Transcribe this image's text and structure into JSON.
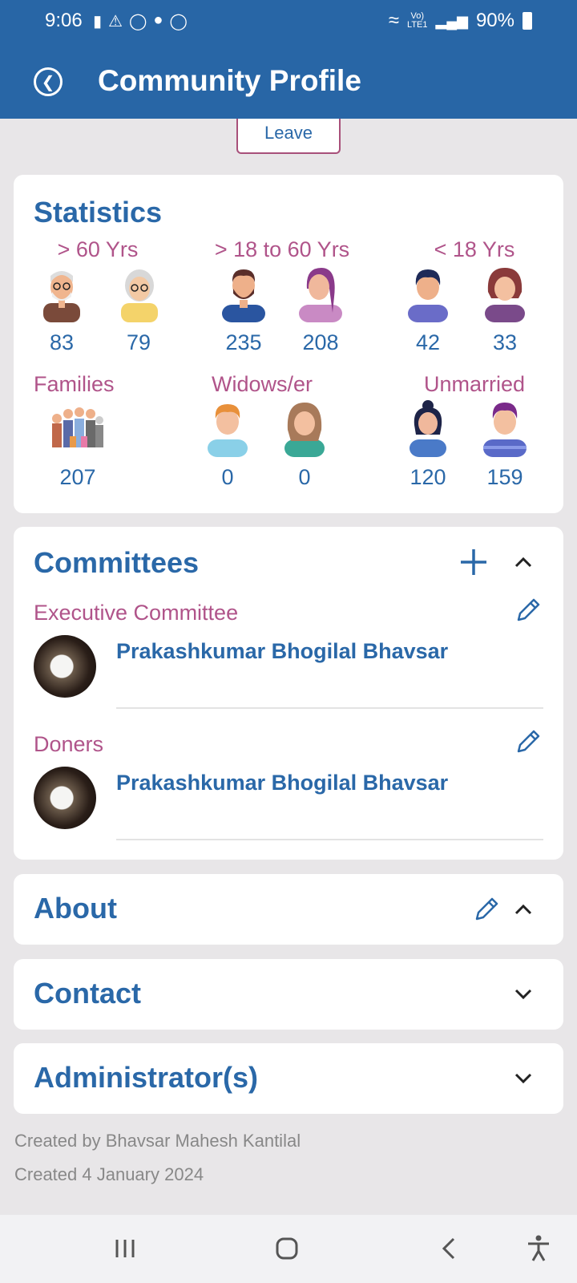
{
  "status_bar": {
    "time": "9:06",
    "network_label_top": "Vo)",
    "network_label_bottom": "LTE1",
    "battery": "90%"
  },
  "header": {
    "title": "Community Profile",
    "back_icon": "back-arrow-icon"
  },
  "leave_button": "Leave",
  "statistics": {
    "title": "Statistics",
    "age_groups": [
      {
        "label": "> 60 Yrs",
        "male": "83",
        "female": "79"
      },
      {
        "label": "> 18 to 60 Yrs",
        "male": "235",
        "female": "208"
      },
      {
        "label": "< 18 Yrs",
        "male": "42",
        "female": "33"
      }
    ],
    "families": {
      "label": "Families",
      "count": "207"
    },
    "widows": {
      "label": "Widows/er",
      "male": "0",
      "female": "0"
    },
    "unmarried": {
      "label": "Unmarried",
      "female": "120",
      "male": "159"
    }
  },
  "committees": {
    "title": "Committees",
    "groups": [
      {
        "name": "Executive Committee",
        "member": "Prakashkumar Bhogilal Bhavsar"
      },
      {
        "name": "Doners",
        "member": "Prakashkumar Bhogilal Bhavsar"
      }
    ]
  },
  "sections": {
    "about": "About",
    "contact": "Contact",
    "administrators": "Administrator(s)"
  },
  "footer": {
    "created_by": "Created by Bhavsar Mahesh Kantilal",
    "created_date": "Created 4 January 2024"
  },
  "colors": {
    "primary": "#2866a6",
    "accent": "#b0548a",
    "background": "#e8e6e8"
  }
}
